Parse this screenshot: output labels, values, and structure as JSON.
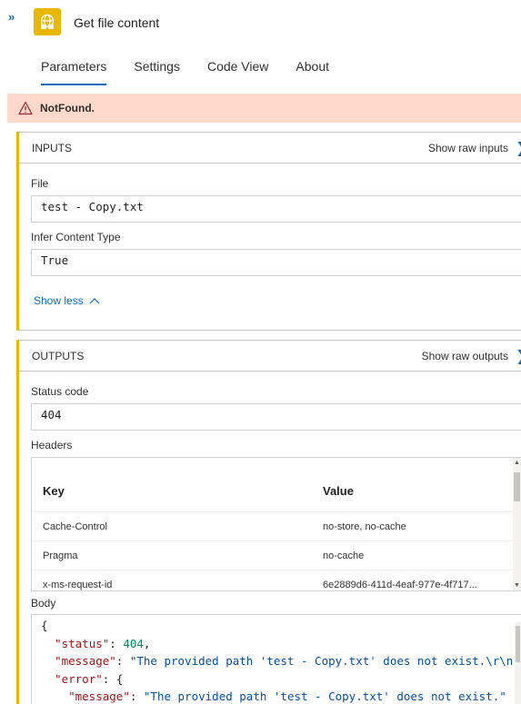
{
  "header": {
    "title": "Get file content",
    "expand_glyph": "»",
    "icon": "sharepoint-globe-icon",
    "accent_color": "#e8b700"
  },
  "tabs": [
    {
      "label": "Parameters",
      "active": true
    },
    {
      "label": "Settings",
      "active": false
    },
    {
      "label": "Code View",
      "active": false
    },
    {
      "label": "About",
      "active": false
    }
  ],
  "error": {
    "text": "NotFound.",
    "background": "#fed9cc",
    "icon": "warning-icon"
  },
  "inputs": {
    "title": "INPUTS",
    "raw_label": "Show raw inputs",
    "fields": [
      {
        "label": "File",
        "value": "test - Copy.txt"
      },
      {
        "label": "Infer Content Type",
        "value": "True"
      }
    ],
    "show_less": "Show less"
  },
  "outputs": {
    "title": "OUTPUTS",
    "raw_label": "Show raw outputs",
    "status_label": "Status code",
    "status_value": "404",
    "headers_label": "Headers",
    "headers_columns": [
      "Key",
      "Value"
    ],
    "headers_rows": [
      {
        "key": "Cache-Control",
        "value": "no-store, no-cache"
      },
      {
        "key": "Pragma",
        "value": "no-cache"
      },
      {
        "key": "x-ms-request-id",
        "value": "6e2889d6-411d-4eaf-977e-4f717..."
      }
    ],
    "body_label": "Body",
    "body_lines": [
      {
        "punct_open": "{"
      },
      {
        "key": "\"status\"",
        "sep": ": ",
        "number": "404",
        "end": ","
      },
      {
        "key": "\"message\"",
        "sep": ": ",
        "string": "\"The provided path 'test - Copy.txt' does not exist.\\r\\n"
      },
      {
        "key": "\"error\"",
        "sep": ": ",
        "punct": "{"
      },
      {
        "key": "\"message\"",
        "sep": ": ",
        "string": "\"The provided path 'test - Copy.txt' does not exist.\""
      }
    ]
  }
}
